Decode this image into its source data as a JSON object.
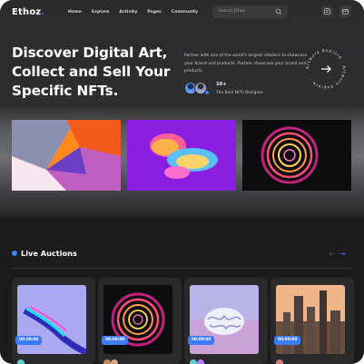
{
  "header": {
    "logo": "Ethoz.",
    "logo_accent": "#3d7bff",
    "nav": [
      "Home",
      "Explore",
      "Activity",
      "Pages",
      "Community"
    ],
    "search_placeholder": "Search Ethoz",
    "icons": [
      "search-icon",
      "wallet-icon",
      "calendar-icon"
    ]
  },
  "hero": {
    "title_lines": [
      "Discover Digital Art,",
      "Collect and Sell Your",
      "Specific NFTs."
    ],
    "description": "Partner with one of the world's largest retailers to showcase your brand and products. Partner showcase your brand and products.",
    "stat_number": "10+",
    "stat_label": "The Best NFTs Designer",
    "circle_text": "Artwork Explore · Artwork Explore ·",
    "circle_icon": "arrow-right-icon"
  },
  "live": {
    "title": "Live Auctions",
    "prev_icon": "arrow-left-icon",
    "next_icon": "arrow-right-icon",
    "cards": [
      {
        "timer": "00:00:00"
      },
      {
        "timer": "00:00:00"
      },
      {
        "timer": "00:00:00"
      },
      {
        "timer": "00:00:00"
      }
    ]
  }
}
